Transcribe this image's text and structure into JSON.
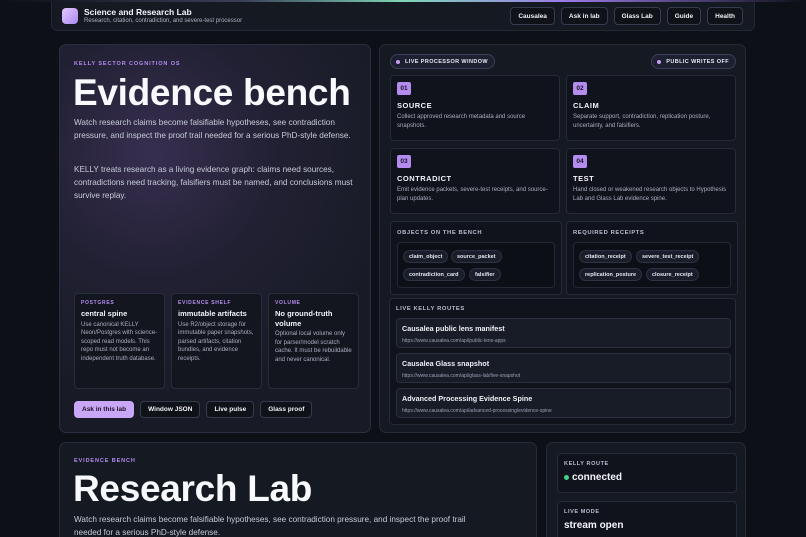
{
  "header": {
    "title": "Science and Research Lab",
    "subtitle": "Research, citation, contradiction, and severe-test processor",
    "nav": [
      "Causalea",
      "Ask in lab",
      "Glass Lab",
      "Guide",
      "Health"
    ]
  },
  "hero": {
    "eyebrow": "KELLY SECTOR COGNITION OS",
    "title": "Evidence bench",
    "p1": "Watch research claims become falsifiable hypotheses, see contradiction pressure, and inspect the proof trail needed for a serious PhD-style defense.",
    "p2": "KELLY treats research as a living evidence graph: claims need sources, contradictions need tracking, falsifiers must be named, and conclusions must survive replay.",
    "cards": [
      {
        "eyebrow": "POSTGRES",
        "title": "central spine",
        "text": "Use canonical KELLY Neon/Postgres with science-scoped read models. This repo must not become an independent truth database."
      },
      {
        "eyebrow": "EVIDENCE SHELF",
        "title": "immutable artifacts",
        "text": "Use R2/object storage for immutable paper snapshots, parsed artifacts, citation bundles, and evidence receipts."
      },
      {
        "eyebrow": "VOLUME",
        "title": "No ground-truth volume",
        "text": "Optional local volume only for parser/model scratch cache. It must be rebuildable and never canonical."
      }
    ],
    "actions": [
      "Ask in this lab",
      "Window JSON",
      "Live pulse",
      "Glass proof"
    ]
  },
  "processor": {
    "window_pill": "LIVE PROCESSOR WINDOW",
    "writes_pill": "PUBLIC WRITES OFF",
    "stages": [
      {
        "num": "01",
        "title": "SOURCE",
        "text": "Collect approved research metadata and source snapshots."
      },
      {
        "num": "02",
        "title": "CLAIM",
        "text": "Separate support, contradiction, replication posture, uncertainty, and falsifiers."
      },
      {
        "num": "03",
        "title": "CONTRADICT",
        "text": "Emit evidence packets, severe-test receipts, and source-plan updates."
      },
      {
        "num": "04",
        "title": "TEST",
        "text": "Hand closed or weakened research objects to Hypothesis Lab and Glass Lab evidence spine."
      }
    ],
    "objects_label": "OBJECTS ON THE BENCH",
    "objects": [
      "claim_object",
      "source_packet",
      "contradiction_card",
      "falsifier"
    ],
    "receipts_label": "REQUIRED RECEIPTS",
    "receipts": [
      "citation_receipt",
      "severe_test_receipt",
      "replication_posture",
      "closure_receipt"
    ],
    "routes_label": "LIVE KELLY ROUTES",
    "routes": [
      {
        "title": "Causalea public lens manifest",
        "url": "https://www.causalea.com/api/public-lens-apps"
      },
      {
        "title": "Causalea Glass snapshot",
        "url": "https://www.causalea.com/api/glass-lab/live-snapshot"
      },
      {
        "title": "Advanced Processing Evidence Spine",
        "url": "https://www.causalea.com/api/advanced-processing/evidence-spine"
      }
    ]
  },
  "lab": {
    "eyebrow": "EVIDENCE BENCH",
    "title": "Research Lab",
    "text": "Watch research claims become falsifiable hypotheses, see contradiction pressure, and inspect the proof trail needed for a serious PhD-style defense."
  },
  "status": {
    "route_label": "KELLY ROUTE",
    "route_value": "connected",
    "mode_label": "LIVE MODE",
    "mode_value": "stream open"
  }
}
